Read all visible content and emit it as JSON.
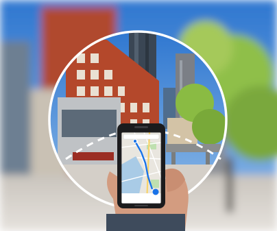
{
  "scene": {
    "subject": "hand-holding-phone-with-map",
    "focus_ring": "white-circle",
    "background": "city-street-buildings-blurred"
  },
  "phone": {
    "screen": {
      "search_placeholder": "",
      "status_bar": ""
    }
  },
  "colors": {
    "sky": "#4a8ed6",
    "brick": "#b24a2e",
    "ring": "#ffffff",
    "map_bg": "#e9e6df",
    "map_road": "#f7d36a",
    "map_water": "#a9cbe6",
    "map_route": "#1a73e8",
    "phone_body": "#1b1b1d",
    "skin": "#d9a58a",
    "foliage": "#7fb342"
  }
}
